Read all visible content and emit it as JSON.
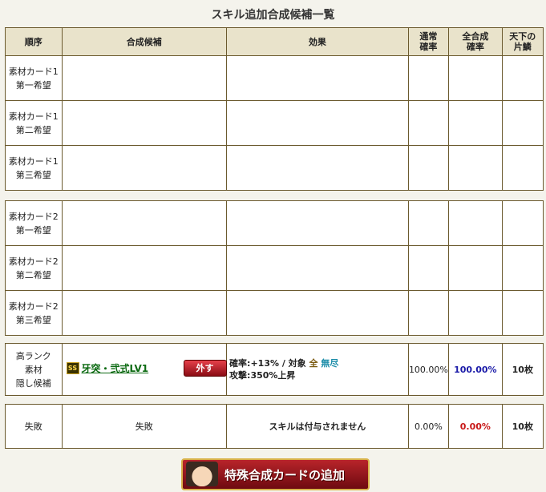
{
  "title": "スキル追加合成候補一覧",
  "headers": {
    "order": "順序",
    "candidate": "合成候補",
    "effect": "効果",
    "normal_rate_1": "通常",
    "normal_rate_2": "確率",
    "full_rate_1": "全合成",
    "full_rate_2": "確率",
    "tenka_1": "天下の",
    "tenka_2": "片鱗"
  },
  "card1": [
    {
      "line1": "素材カード1",
      "line2": "第一希望"
    },
    {
      "line1": "素材カード1",
      "line2": "第二希望"
    },
    {
      "line1": "素材カード1",
      "line2": "第三希望"
    }
  ],
  "card2": [
    {
      "line1": "素材カード2",
      "line2": "第一希望"
    },
    {
      "line1": "素材カード2",
      "line2": "第二希望"
    },
    {
      "line1": "素材カード2",
      "line2": "第三希望"
    }
  ],
  "hidden": {
    "label_1": "高ランク",
    "label_2": "素材",
    "label_3": "隠し候補",
    "badge": "SS",
    "skill_name": "牙突・弐式LV1",
    "remove_label": "外す",
    "effect_rate": "確率:+13%",
    "effect_sep": " / 対象 ",
    "effect_all": "全",
    "effect_inf": "無尽",
    "effect_line2": "攻撃:350%上昇",
    "normal_rate": "100.00%",
    "full_rate": "100.00%",
    "count": "10枚"
  },
  "failure": {
    "label": "失敗",
    "candidate": "失敗",
    "effect": "スキルは付与されません",
    "normal_rate": "0.00%",
    "full_rate": "0.00%",
    "count": "10枚"
  },
  "special_button": "特殊合成カードの追加",
  "colors": {
    "header_bg": "#e9e3cb",
    "border": "#6b5a2e",
    "full_rate_blue": "#1a1aa8",
    "full_rate_red": "#c81818",
    "skill_green": "#0c6a12"
  }
}
